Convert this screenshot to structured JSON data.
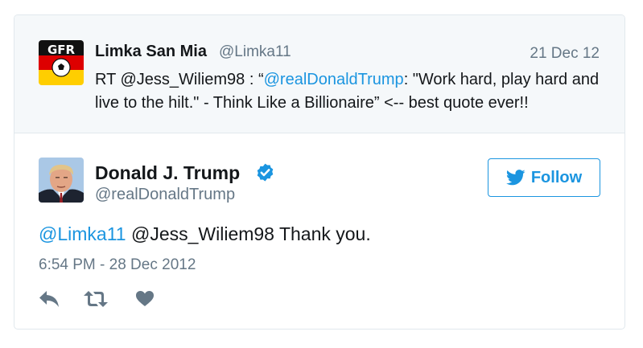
{
  "parent_tweet": {
    "avatar_text": "GFR",
    "author_name": "Limka San Mia",
    "author_handle": "@Limka11",
    "date": "21 Dec 12",
    "text_prefix": "RT @Jess_Wiliem98 : “",
    "text_mention": "@realDonaldTrump",
    "text_suffix": ": \"Work hard, play hard and live to the hilt.\" - Think Like a Billionaire” <-- best quote ever!!"
  },
  "main_tweet": {
    "author_name": "Donald J. Trump",
    "author_handle": "@realDonaldTrump",
    "verified": true,
    "follow_label": "Follow",
    "text_mention": "@Limka11",
    "text_rest": " @Jess_Wiliem98 Thank you.",
    "timestamp": "6:54 PM - 28 Dec 2012"
  },
  "actions": [
    {
      "icon": "reply-icon"
    },
    {
      "icon": "retweet-icon"
    },
    {
      "icon": "like-icon"
    }
  ],
  "colors": {
    "link": "#1b95e0",
    "secondary_text": "#657786",
    "parent_background": "#f5f8fa",
    "border": "#e1e8ed"
  }
}
